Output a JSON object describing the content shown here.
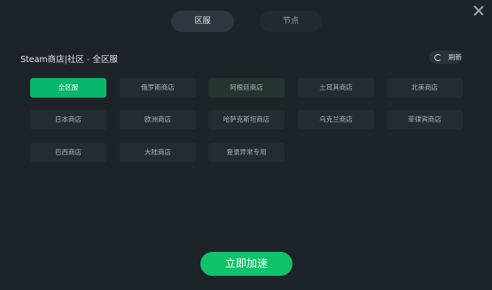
{
  "tabs": [
    {
      "label": "区服"
    },
    {
      "label": "节点"
    }
  ],
  "section": {
    "title_main": "Steam商店|社区",
    "title_sep": " - ",
    "title_sub": "全区服"
  },
  "refresh_label": "刷新",
  "regions": [
    "全区服",
    "俄罗斯商店",
    "阿根廷商店",
    "土耳其商店",
    "北美商店",
    "日本商店",
    "欧洲商店",
    "哈萨克斯坦商店",
    "乌克兰商店",
    "菲律宾商店",
    "巴西商店",
    "大陆商店",
    "登录异常专用"
  ],
  "accelerate_label": "立即加速"
}
